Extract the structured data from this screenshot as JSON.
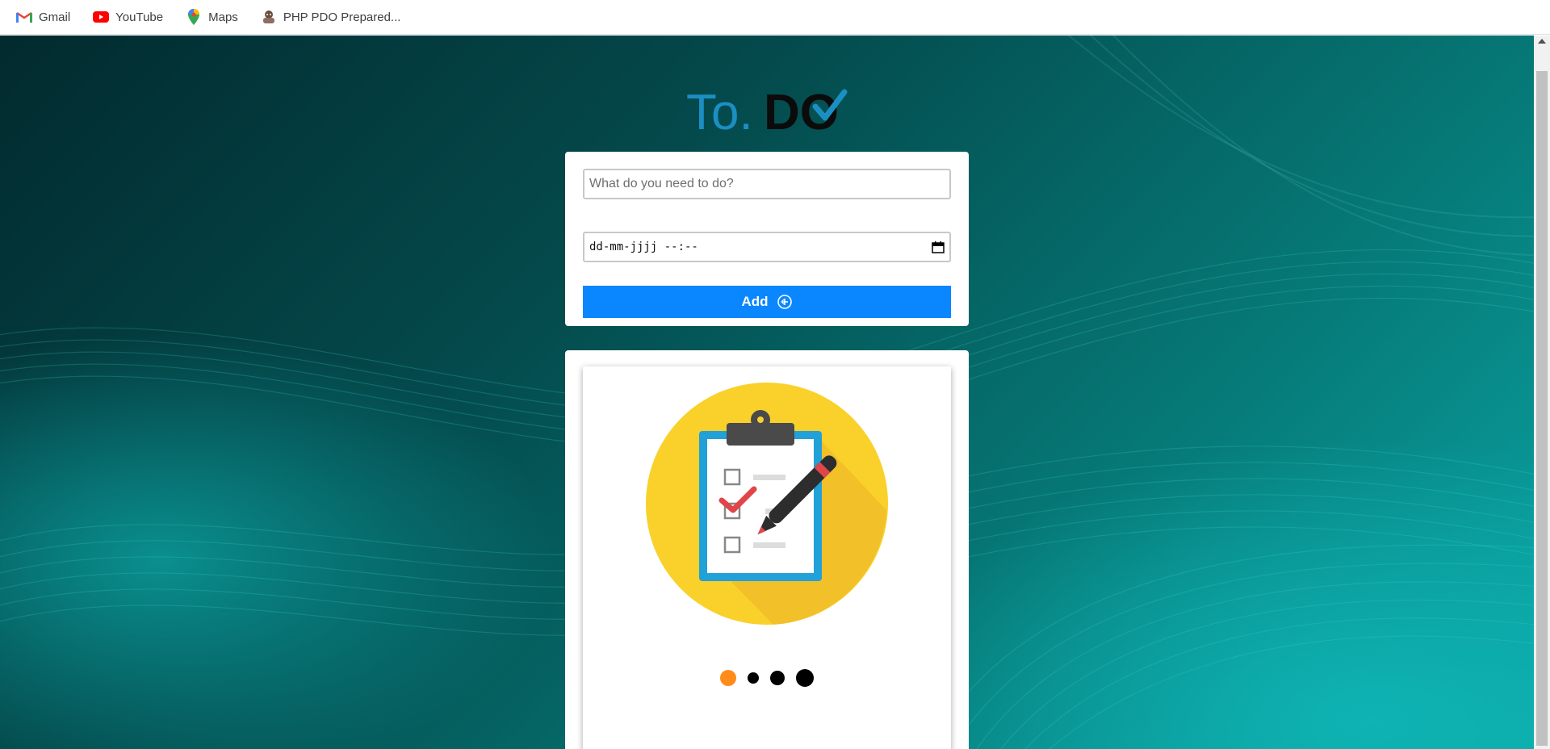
{
  "bookmarks": [
    {
      "label": "Gmail",
      "icon": "gmail-icon"
    },
    {
      "label": "YouTube",
      "icon": "youtube-icon"
    },
    {
      "label": "Maps",
      "icon": "maps-pin-icon"
    },
    {
      "label": "PHP PDO Prepared...",
      "icon": "site-favicon-icon"
    }
  ],
  "logo": {
    "text_light": "To.",
    "text_bold": "DO",
    "accent_color": "#1b8fc4"
  },
  "form": {
    "todo_placeholder": "What do you need to do?",
    "date_placeholder": "dd-mm-jjjj --:--",
    "add_label": "Add",
    "add_color": "#0a87ff"
  },
  "carousel": {
    "slide_icon": "clipboard-checklist-icon",
    "dots": [
      {
        "index": 1,
        "active": true
      },
      {
        "index": 2,
        "active": false
      },
      {
        "index": 3,
        "active": false
      },
      {
        "index": 4,
        "active": false
      }
    ],
    "active_color": "#ff8c1a"
  }
}
